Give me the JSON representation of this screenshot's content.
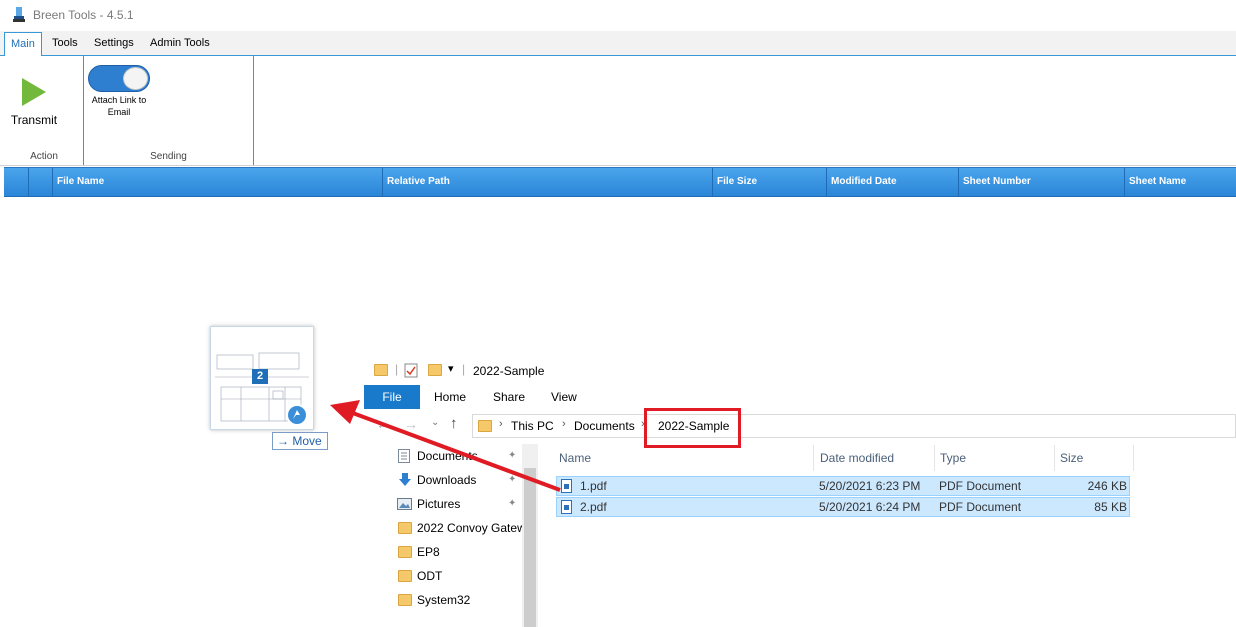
{
  "app": {
    "title": "Breen Tools - 4.5.1"
  },
  "ribbon_tabs": [
    {
      "label": "Main",
      "active": true
    },
    {
      "label": "Tools",
      "active": false
    },
    {
      "label": "Settings",
      "active": false
    },
    {
      "label": "Admin Tools",
      "active": false
    }
  ],
  "ribbon": {
    "transmit_label": "Transmit",
    "action_group_label": "Action",
    "attach_toggle_label": "Attach Link to Email",
    "attach_toggle_on": true,
    "sending_group_label": "Sending"
  },
  "grid": {
    "columns": [
      "File Name",
      "Relative Path",
      "File Size",
      "Modified Date",
      "Sheet Number",
      "Sheet Name"
    ],
    "header_color": "#2f8ce0"
  },
  "drag": {
    "count": "2",
    "tooltip": "Move",
    "tooltip_icon": "arrow-right-icon"
  },
  "explorer": {
    "window_title": "2022-Sample",
    "ribbon_tabs": [
      "File",
      "Home",
      "Share",
      "View"
    ],
    "breadcrumb": [
      "This PC",
      "Documents",
      "2022-Sample"
    ],
    "nav_items": [
      {
        "label": "Documents",
        "icon": "documents-icon",
        "pinned": true
      },
      {
        "label": "Downloads",
        "icon": "download-arrow-icon",
        "pinned": true
      },
      {
        "label": "Pictures",
        "icon": "pictures-icon",
        "pinned": true
      },
      {
        "label": "2022 Convoy Gatew",
        "icon": "folder-icon",
        "pinned": false
      },
      {
        "label": "EP8",
        "icon": "folder-icon",
        "pinned": false
      },
      {
        "label": "ODT",
        "icon": "folder-icon",
        "pinned": false
      },
      {
        "label": "System32",
        "icon": "folder-icon",
        "pinned": false
      }
    ],
    "columns": [
      "Name",
      "Date modified",
      "Type",
      "Size"
    ],
    "files": [
      {
        "name": "1.pdf",
        "date": "5/20/2021 6:23 PM",
        "type": "PDF Document",
        "size": "246 KB"
      },
      {
        "name": "2.pdf",
        "date": "5/20/2021 6:24 PM",
        "type": "PDF Document",
        "size": "85 KB"
      }
    ]
  },
  "annotation_color": "#e01b24"
}
